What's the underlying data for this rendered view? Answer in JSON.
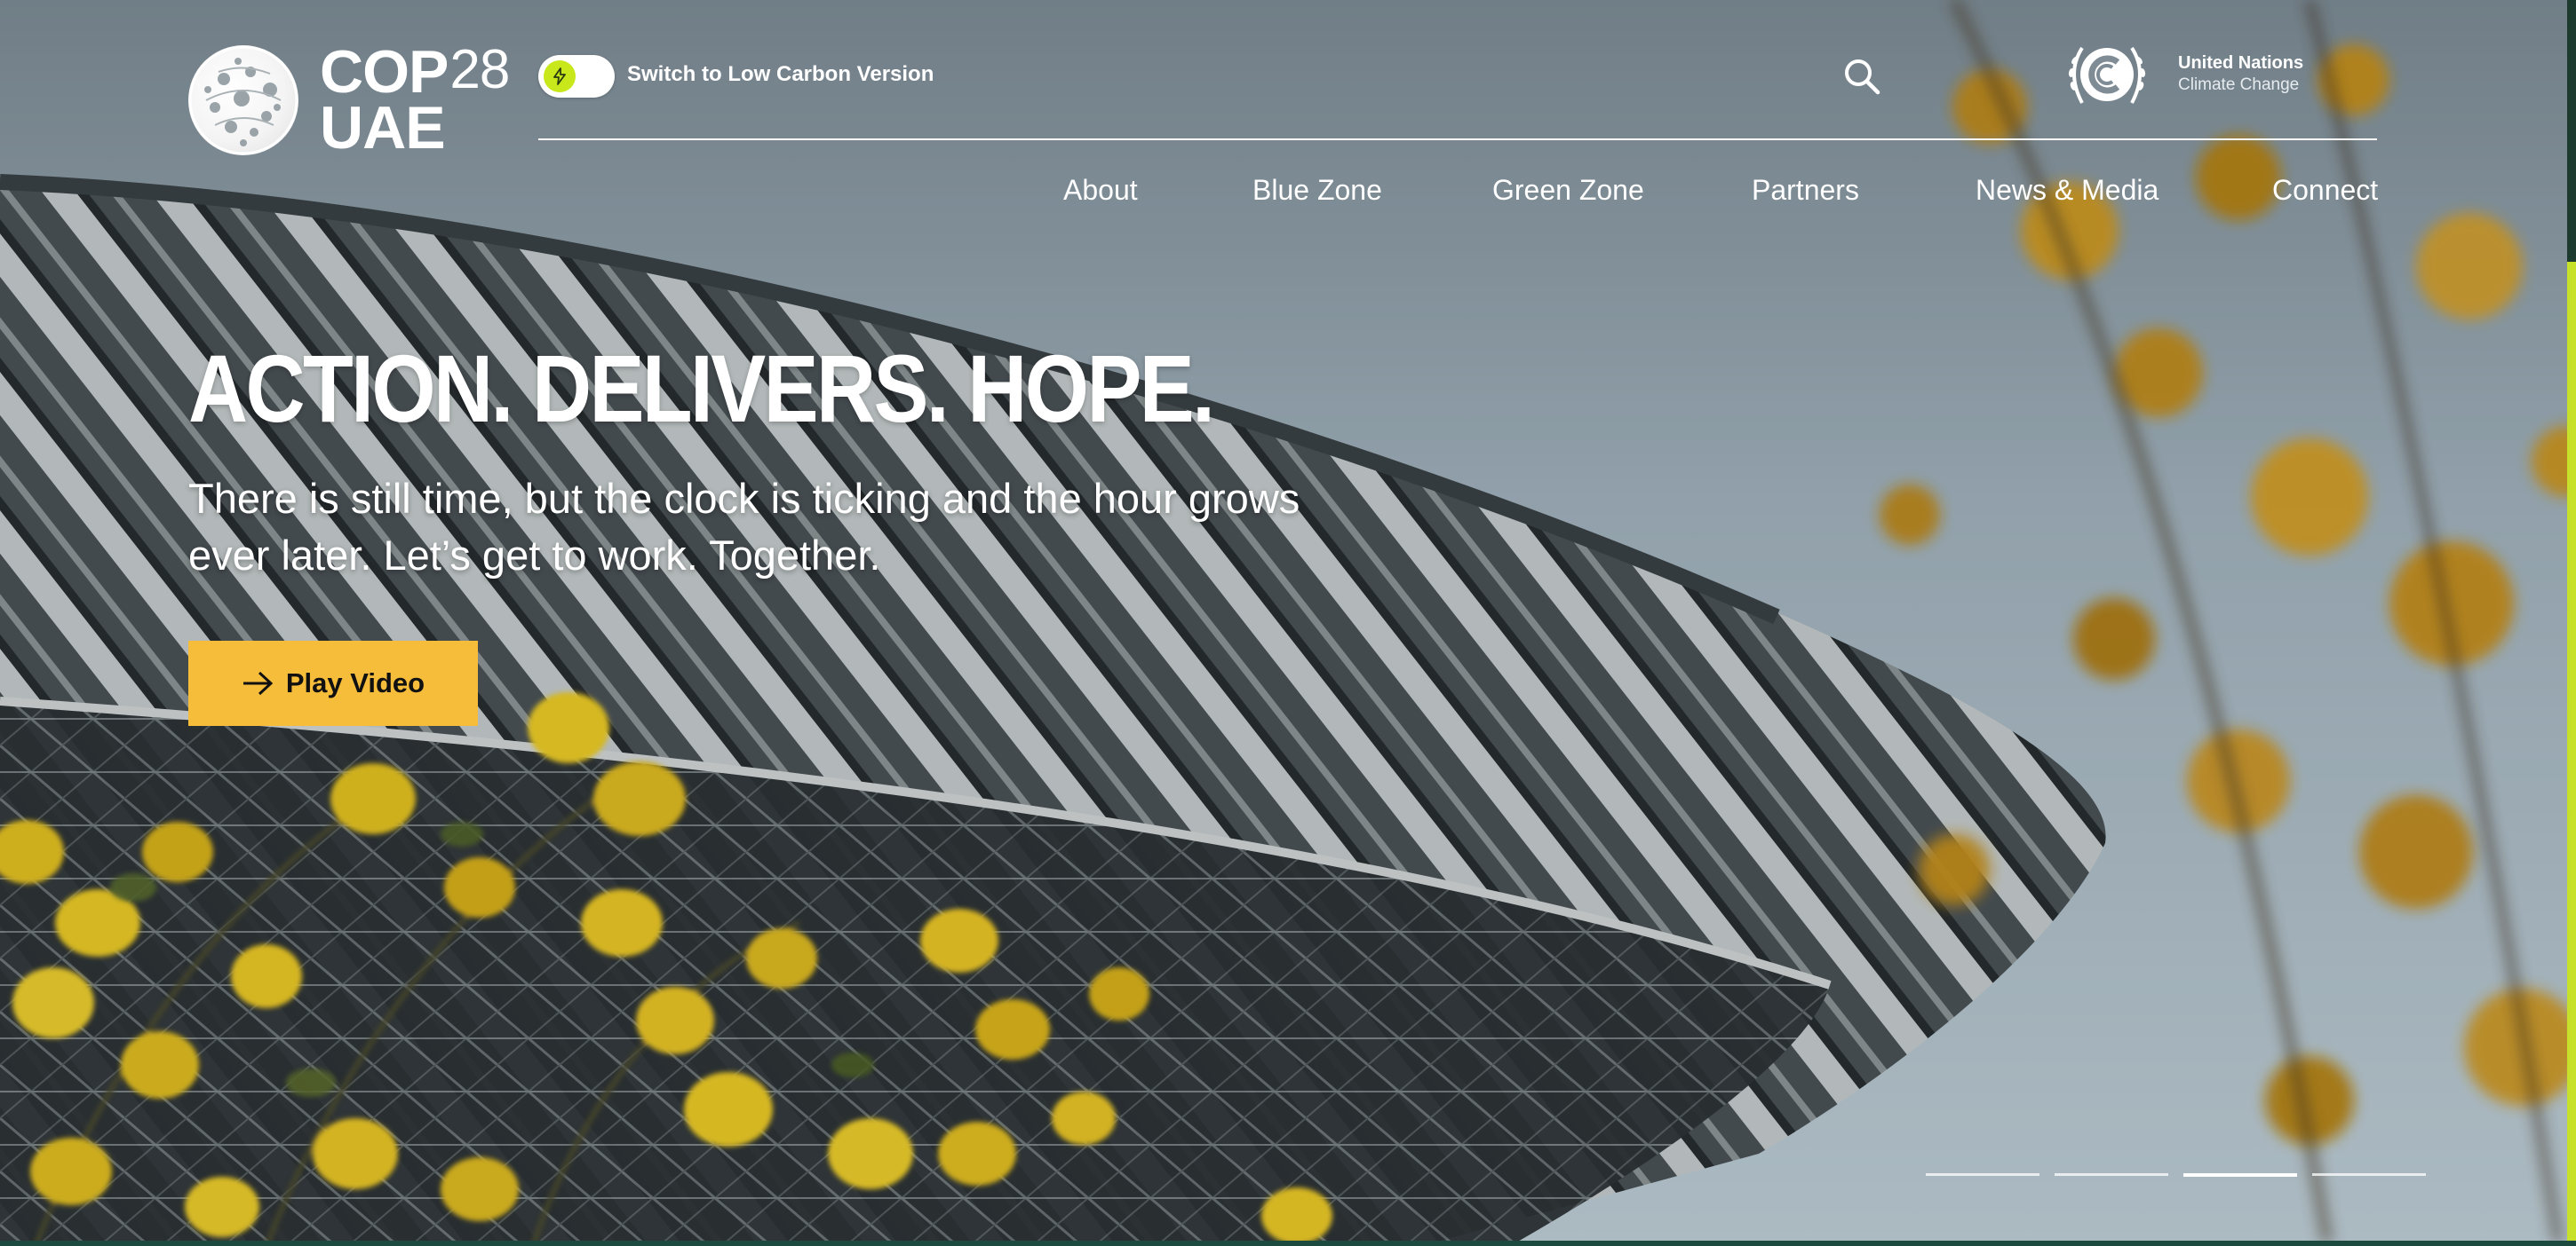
{
  "brand": {
    "logo_line1": "COP",
    "logo_line1_number": "28",
    "logo_line2": "UAE",
    "globe_icon": "cop28-globe-icon"
  },
  "header": {
    "toggle_label": "Switch to Low Carbon Version",
    "toggle_icon": "lightning-icon",
    "search_icon": "search-icon",
    "partner_line1": "United Nations",
    "partner_line2": "Climate Change",
    "partner_icon": "unfccc-laurel-icon"
  },
  "nav": {
    "items": [
      {
        "label": "About"
      },
      {
        "label": "Blue Zone"
      },
      {
        "label": "Green Zone"
      },
      {
        "label": "Partners"
      },
      {
        "label": "News & Media"
      },
      {
        "label": "Connect"
      }
    ]
  },
  "hero": {
    "headline": "ACTION. DELIVERS. HOPE.",
    "subtitle": "There is still time, but the clock is ticking and the hour grows ever later. Let’s get to work. Together.",
    "cta_label": "Play Video",
    "cta_icon": "arrow-right-icon",
    "slides_total": 4,
    "active_slide": 3
  },
  "colors": {
    "accent": "#f6bd3b",
    "toggle_green": "#c8e81c",
    "header_text": "#ffffff"
  }
}
